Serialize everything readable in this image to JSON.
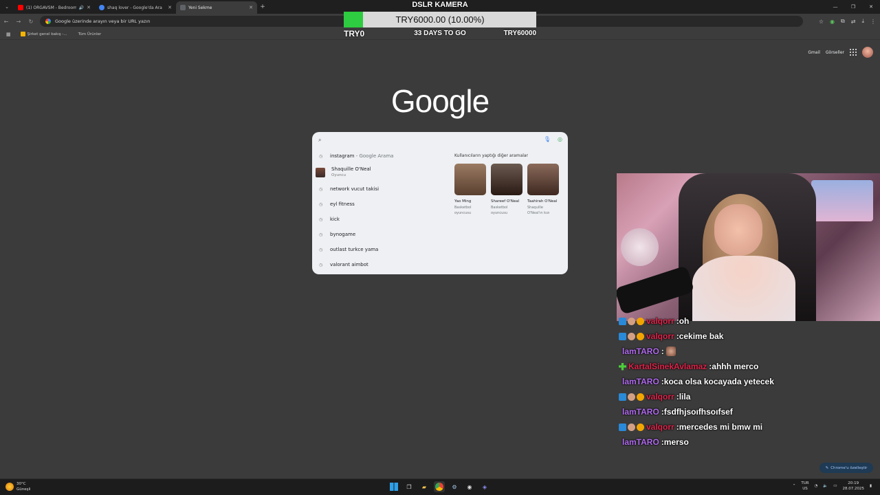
{
  "browser": {
    "tabs": [
      {
        "title": "(1) ORGAVSM - Bedroom P",
        "favicon_color": "#ff0000",
        "sound": true,
        "active": false
      },
      {
        "title": "shaq lover - Google'da Ara",
        "favicon_color": "#4285f4",
        "sound": false,
        "active": false
      },
      {
        "title": "Yeni Sekme",
        "favicon_color": "#5f6368",
        "sound": false,
        "active": true
      }
    ],
    "omnibox_placeholder": "Google üzerinde arayın veya bir URL yazın",
    "bookmarks": [
      "Şirket genel bakış -...",
      "Tüm Ürünler"
    ]
  },
  "donation_goal": {
    "title": "DSLR KAMERA",
    "amount_text": "TRY6000.00 (10.00%)",
    "progress_fraction": 0.1,
    "min_label": "TRY0",
    "days_label": "33 DAYS TO GO",
    "max_label": "TRY60000",
    "fill_color": "#2ecc40"
  },
  "google": {
    "links": [
      "Gmail",
      "Görseller"
    ],
    "logo": "Google",
    "suggestions": [
      {
        "text": "instagram",
        "sub": " - Google Arama",
        "type": "history"
      },
      {
        "text": "Shaquille O'Neal",
        "sub": "Oyuncu",
        "type": "person"
      },
      {
        "text": "network vucut takisi",
        "sub": "",
        "type": "history"
      },
      {
        "text": "eyl fitness",
        "sub": "",
        "type": "history"
      },
      {
        "text": "kick",
        "sub": "",
        "type": "history"
      },
      {
        "text": "bynogame",
        "sub": "",
        "type": "history"
      },
      {
        "text": "outlast turkce yama",
        "sub": "",
        "type": "history"
      },
      {
        "text": "valorant aimbot",
        "sub": "",
        "type": "history"
      }
    ],
    "related_header": "Kullanıcıların yaptığı diğer aramalar",
    "related": [
      {
        "name": "Yao Ming",
        "desc": "Basketbol oyuncusu",
        "color": "#8a6a52"
      },
      {
        "name": "Shareef O'Neal",
        "desc": "Basketbol oyuncusu",
        "color": "#4f3a30"
      },
      {
        "name": "Taahirah O'Neal",
        "desc": "Shaquille O'Neal'ın kızı",
        "color": "#6e4a3c"
      }
    ]
  },
  "chat": [
    {
      "badges": [
        "blue",
        "paw",
        "gold"
      ],
      "user": "valqorr",
      "user_color": "#e0244a",
      "text": "oh"
    },
    {
      "badges": [
        "blue",
        "paw",
        "gold"
      ],
      "user": "valqorr",
      "user_color": "#e0244a",
      "text": "cekime bak"
    },
    {
      "badges": [],
      "user": "lamTARO",
      "user_color": "#b16cf0",
      "text": "",
      "emote": true
    },
    {
      "badges": [
        "green"
      ],
      "user": "KartalSinekAvlamaz",
      "user_color": "#e0244a",
      "text": "ahhh merco"
    },
    {
      "badges": [],
      "user": "lamTARO",
      "user_color": "#b16cf0",
      "text": "koca olsa kocayada yetecek"
    },
    {
      "badges": [
        "blue",
        "paw",
        "gold"
      ],
      "user": "valqorr",
      "user_color": "#e0244a",
      "text": "lila"
    },
    {
      "badges": [],
      "user": "lamTARO",
      "user_color": "#b16cf0",
      "text": "fsdfhjsoıfhsoıfsef"
    },
    {
      "badges": [
        "blue",
        "paw",
        "gold"
      ],
      "user": "valqorr",
      "user_color": "#e0244a",
      "text": "mercedes mi bmw mi"
    },
    {
      "badges": [],
      "user": "lamTARO",
      "user_color": "#b16cf0",
      "text": "merso"
    }
  ],
  "customize_label": "Chrome'u özelleştir",
  "taskbar": {
    "weather_temp": "30°C",
    "weather_desc": "Güneşli",
    "lang_top": "TUR",
    "lang_bottom": "US",
    "time": "20:19",
    "date": "28.07.2025"
  }
}
